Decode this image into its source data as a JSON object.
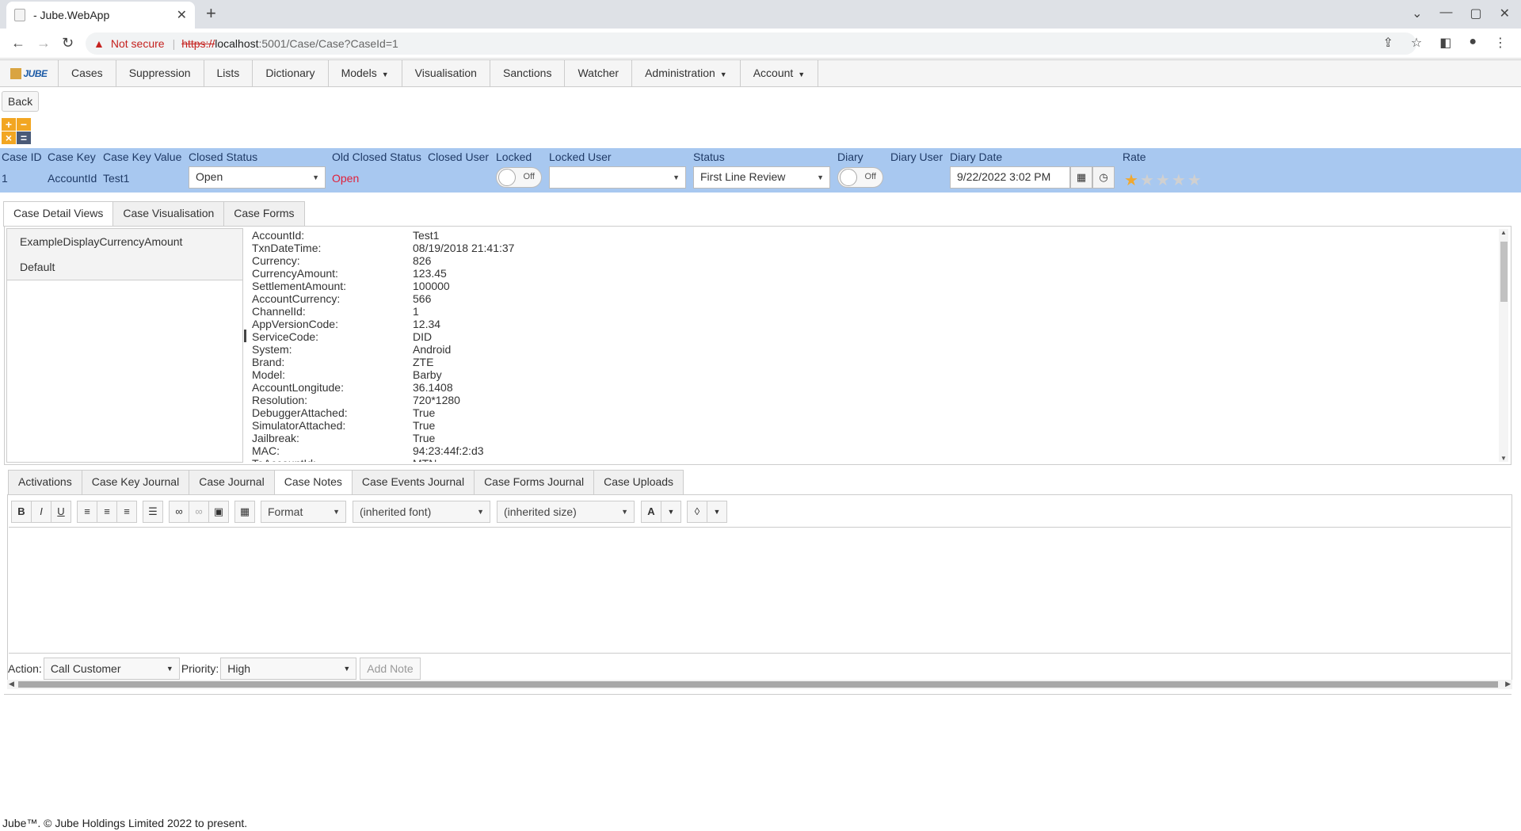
{
  "browser": {
    "tab_title": "- Jube.WebApp",
    "not_secure": "Not secure",
    "url_scheme": "https://",
    "url_host": "localhost",
    "url_path": ":5001/Case/Case?CaseId=1"
  },
  "menu": {
    "logo": "JUBE",
    "items": [
      "Cases",
      "Suppression",
      "Lists",
      "Dictionary",
      "Models",
      "Visualisation",
      "Sanctions",
      "Watcher",
      "Administration",
      "Account"
    ]
  },
  "back_label": "Back",
  "case": {
    "headers": {
      "case_id": "Case ID",
      "case_key": "Case Key",
      "case_key_value": "Case Key Value",
      "closed_status": "Closed Status",
      "old_closed_status": "Old Closed Status",
      "closed_user": "Closed User",
      "locked": "Locked",
      "locked_user": "Locked User",
      "status": "Status",
      "diary": "Diary",
      "diary_user": "Diary User",
      "diary_date": "Diary Date",
      "rate": "Rate"
    },
    "case_id": "1",
    "case_key": "AccountId",
    "case_key_value": "Test1",
    "closed_status": "Open",
    "old_closed_status": "Open",
    "locked": "Off",
    "locked_user": "",
    "status": "First Line Review",
    "diary": "Off",
    "diary_date": "9/22/2022 3:02 PM",
    "rating": 1,
    "rating_max": 5,
    "old_status_color": "#e0203a",
    "star_color": "#f0a830"
  },
  "detail_tabs": [
    "Case Detail Views",
    "Case Visualisation",
    "Case Forms"
  ],
  "views": [
    "ExampleDisplayCurrencyAmount",
    "Default"
  ],
  "fields": [
    {
      "key": "AccountId:",
      "value": "Test1"
    },
    {
      "key": "TxnDateTime:",
      "value": "08/19/2018 21:41:37"
    },
    {
      "key": "Currency:",
      "value": "826"
    },
    {
      "key": "CurrencyAmount:",
      "value": "123.45"
    },
    {
      "key": "SettlementAmount:",
      "value": "100000"
    },
    {
      "key": "AccountCurrency:",
      "value": "566"
    },
    {
      "key": "ChannelId:",
      "value": "1"
    },
    {
      "key": "AppVersionCode:",
      "value": "12.34"
    },
    {
      "key": "ServiceCode:",
      "value": "DID"
    },
    {
      "key": "System:",
      "value": "Android"
    },
    {
      "key": "Brand:",
      "value": "ZTE"
    },
    {
      "key": "Model:",
      "value": "Barby"
    },
    {
      "key": "AccountLongitude:",
      "value": "36.1408"
    },
    {
      "key": "Resolution:",
      "value": "720*1280"
    },
    {
      "key": "DebuggerAttached:",
      "value": "True"
    },
    {
      "key": "SimulatorAttached:",
      "value": "True"
    },
    {
      "key": "Jailbreak:",
      "value": "True"
    },
    {
      "key": "MAC:",
      "value": "94:23:44f:2:d3"
    },
    {
      "key": "ToAccountId:",
      "value": "MTN"
    }
  ],
  "journal_tabs": [
    "Activations",
    "Case Key Journal",
    "Case Journal",
    "Case Notes",
    "Case Events Journal",
    "Case Forms Journal",
    "Case Uploads"
  ],
  "editor": {
    "format": "Format",
    "font": "(inherited font)",
    "size": "(inherited size)",
    "text_color": "A"
  },
  "note": {
    "action_label": "Action:",
    "action_value": "Call Customer",
    "priority_label": "Priority:",
    "priority_value": "High",
    "add_note": "Add Note"
  },
  "footer": "Jube™. © Jube Holdings Limited 2022 to present."
}
